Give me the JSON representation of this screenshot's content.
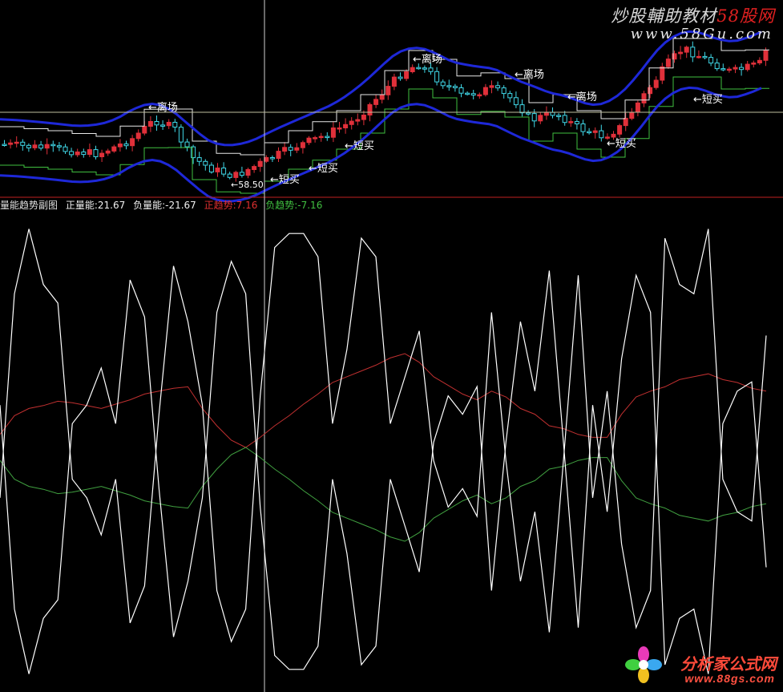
{
  "colors": {
    "background": "#000000",
    "price_up": "#e0303a",
    "price_down": "#40d8e8",
    "band": "#1e28d8",
    "support": "#40c040",
    "resistance": "#e8e8e8",
    "pos_trend": "#c03030",
    "neg_trend": "#40a040",
    "energy": "#ffffff",
    "separator": "#c02020",
    "crosshair": "#d0d0d0",
    "cursor_h": "#c0c0a0"
  },
  "indicator": {
    "title": "量能趋势副图",
    "pos_energy_label": "正量能:",
    "pos_energy_value": "21.67",
    "neg_energy_label": "负量能:",
    "neg_energy_value": "-21.67",
    "pos_trend_label": "正趋势:",
    "pos_trend_value": "7.16",
    "neg_trend_label": "负趋势:",
    "neg_trend_value": "-7.16"
  },
  "signals": {
    "exit": "←离场",
    "short_buy": "←短买",
    "low_price": "←58.50"
  },
  "watermarks": {
    "top_main": "炒股輔助教材",
    "top_red": "58股网",
    "top_url": "www.58Gu.com",
    "bottom_main": "分析家公式网",
    "bottom_url": "www.88gs.com"
  },
  "chart_data": {
    "type": "line",
    "panels": [
      "price-candlestick",
      "energy-trend-indicator"
    ],
    "price_low_marker": 58.5,
    "indicator_values": {
      "pos_energy": 21.67,
      "neg_energy": -21.67,
      "pos_trend": 7.16,
      "neg_trend": -7.16
    },
    "energy_white": [
      0.4,
      0.84,
      0.98,
      0.86,
      0.82,
      0.44,
      0.4,
      0.32,
      0.44,
      0.13,
      0.21,
      0.58,
      0.9,
      0.78,
      0.6,
      0.2,
      0.09,
      0.16,
      0.62,
      0.94,
      0.97,
      0.97,
      0.92,
      0.56,
      0.72,
      0.96,
      0.92,
      0.56,
      0.66,
      0.76,
      0.48,
      0.38,
      0.42,
      0.36,
      0.8,
      0.48,
      0.22,
      0.37,
      0.11,
      0.49,
      0.88,
      0.4,
      0.63,
      0.3,
      0.12,
      0.2,
      0.96,
      0.86,
      0.84,
      0.98,
      0.44,
      0.37,
      0.35,
      0.75
    ],
    "pos_trend": [
      0.12,
      0.25,
      0.3,
      0.32,
      0.35,
      0.34,
      0.32,
      0.3,
      0.33,
      0.36,
      0.4,
      0.42,
      0.44,
      0.45,
      0.3,
      0.18,
      0.08,
      0.03,
      0.1,
      0.18,
      0.25,
      0.33,
      0.4,
      0.48,
      0.52,
      0.56,
      0.6,
      0.65,
      0.68,
      0.62,
      0.52,
      0.46,
      0.4,
      0.36,
      0.42,
      0.38,
      0.3,
      0.26,
      0.18,
      0.16,
      0.12,
      0.1,
      0.1,
      0.26,
      0.38,
      0.42,
      0.45,
      0.5,
      0.52,
      0.54,
      0.5,
      0.48,
      0.44,
      0.42
    ]
  }
}
